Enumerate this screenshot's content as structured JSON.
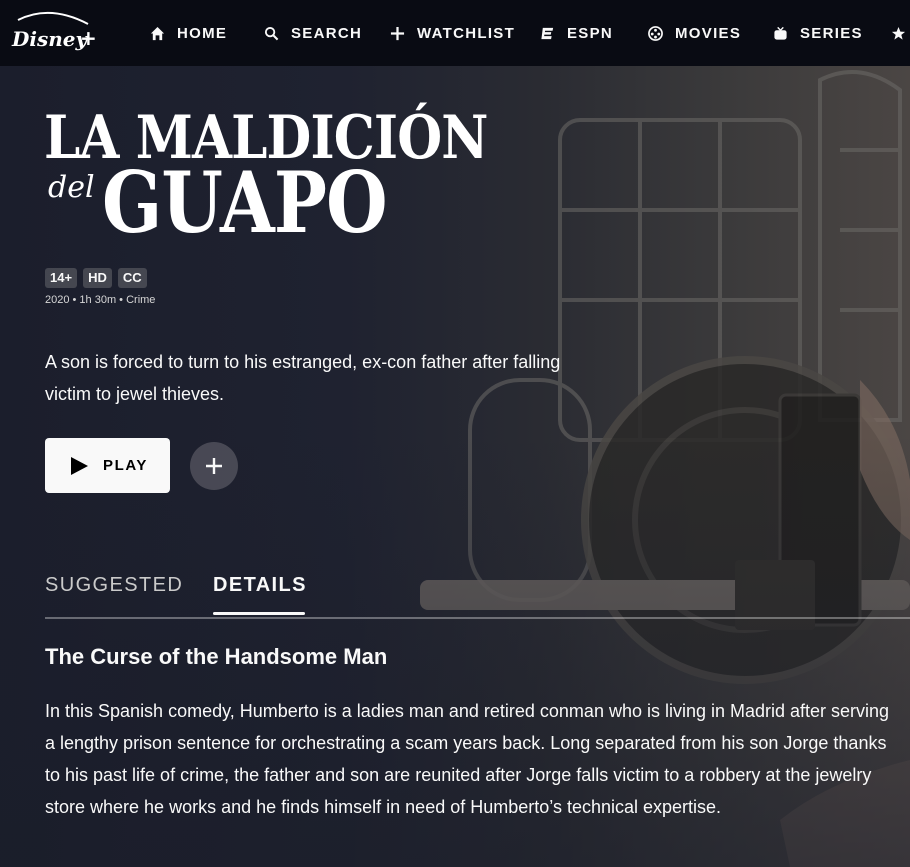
{
  "brand": {
    "logo_text": "Disney+"
  },
  "nav": {
    "items": [
      {
        "label": "HOME",
        "icon": "home-icon"
      },
      {
        "label": "SEARCH",
        "icon": "search-icon"
      },
      {
        "label": "WATCHLIST",
        "icon": "plus-icon"
      },
      {
        "label": "ESPN",
        "icon": "espn-icon"
      },
      {
        "label": "MOVIES",
        "icon": "movies-icon"
      },
      {
        "label": "SERIES",
        "icon": "tv-icon"
      },
      {
        "label": "",
        "icon": "star-icon"
      }
    ]
  },
  "title": {
    "line1": "LA MALDICIÓN",
    "small": "del",
    "line2": "GUAPO"
  },
  "badges": [
    "14+",
    "HD",
    "CC"
  ],
  "meta": "2020 • 1h 30m • Crime",
  "description": "A son is forced to turn to his estranged, ex-con father after falling victim to jewel thieves.",
  "actions": {
    "play_label": "PLAY",
    "add_icon": "plus-icon"
  },
  "tabs": [
    {
      "label": "SUGGESTED",
      "selected": false
    },
    {
      "label": "DETAILS",
      "selected": true
    }
  ],
  "details": {
    "title": "The Curse of the Handsome Man",
    "body": "In this Spanish comedy, Humberto is a ladies man and retired conman who is living in Madrid after serving a lengthy prison sentence for orchestrating a scam years back. Long separated from his son Jorge thanks to his past life of crime, the father and son are reunited after Jorge falls victim to a robbery at the jewelry store where he works and he finds himself in need of Humberto’s technical expertise."
  },
  "colors": {
    "nav_bg": "#090b13",
    "page_bg": "#1a1d29",
    "text": "#f9f9f9",
    "play_bg": "#f9f9f9"
  }
}
